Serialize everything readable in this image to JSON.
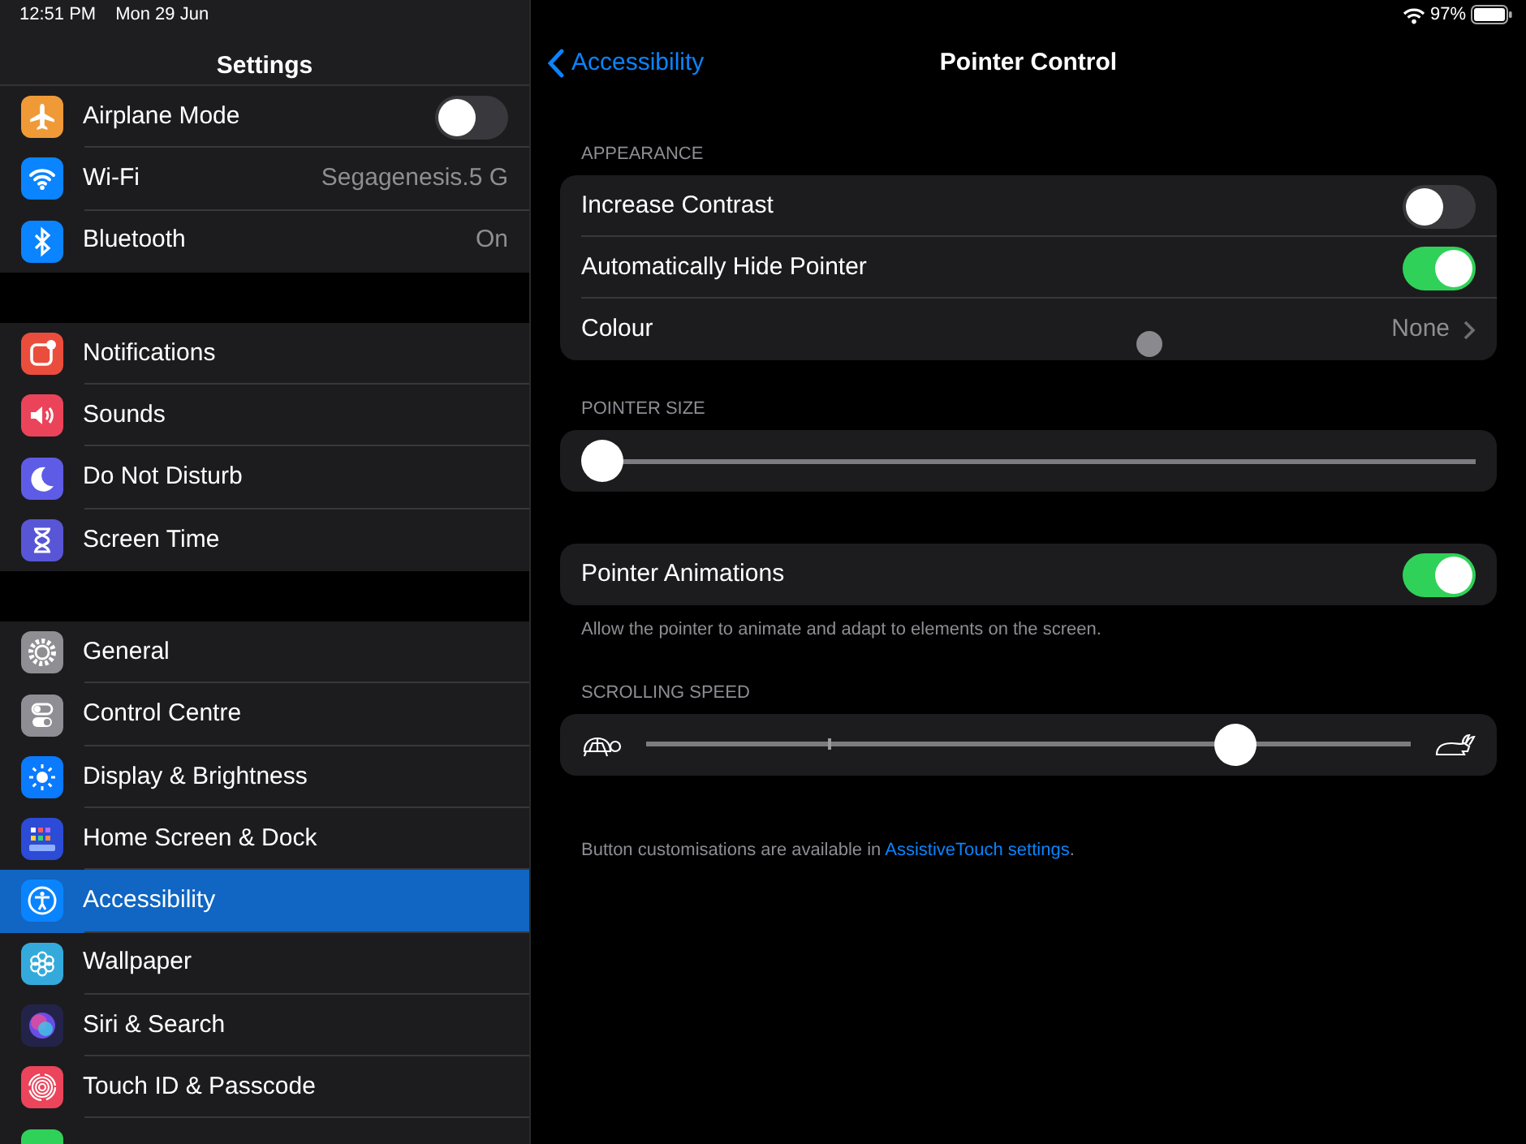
{
  "status_bar": {
    "time": "12:51 PM",
    "date": "Mon 29 Jun",
    "battery": "97%"
  },
  "sidebar": {
    "title": "Settings",
    "groups": [
      {
        "items": [
          {
            "label": "Airplane Mode",
            "kind": "airplane",
            "color": "#f09a37",
            "on": false,
            "selected": false
          },
          {
            "label": "Wi-Fi",
            "kind": "wifi",
            "color": "#0a84ff",
            "value": "Segagenesis.5 G",
            "selected": false
          },
          {
            "label": "Bluetooth",
            "kind": "bluetooth",
            "color": "#0a84ff",
            "value": "On",
            "selected": false
          }
        ]
      },
      {
        "items": [
          {
            "label": "Notifications",
            "kind": "notification",
            "color": "#eb4d3d",
            "selected": false
          },
          {
            "label": "Sounds",
            "kind": "speaker",
            "color": "#eb445a",
            "selected": false
          },
          {
            "label": "Do Not Disturb",
            "kind": "moon",
            "color": "#5e5ce6",
            "selected": false
          },
          {
            "label": "Screen Time",
            "kind": "hourglass",
            "color": "#5856d6",
            "selected": false
          }
        ]
      },
      {
        "items": [
          {
            "label": "General",
            "kind": "gear",
            "color": "#8e8e93",
            "selected": false
          },
          {
            "label": "Control Centre",
            "kind": "toggles",
            "color": "#8e8e94",
            "selected": false
          },
          {
            "label": "Display & Brightness",
            "kind": "sun",
            "color": "#0a7aff",
            "selected": false
          },
          {
            "label": "Home Screen & Dock",
            "kind": "grid",
            "color": "#2c4bd6",
            "selected": false
          },
          {
            "label": "Accessibility",
            "kind": "accessibility",
            "color": "#0a84fe",
            "selected": true
          },
          {
            "label": "Wallpaper",
            "kind": "flower",
            "color": "#34aadc",
            "selected": false
          },
          {
            "label": "Siri & Search",
            "kind": "orb",
            "color": "#23234a",
            "selected": false
          },
          {
            "label": "Touch ID & Passcode",
            "kind": "fingerprint",
            "color": "#eb445b",
            "selected": false
          },
          {
            "kind": "battery",
            "color": "#30d158",
            "selected": false
          }
        ]
      }
    ]
  },
  "nav": {
    "back": "Accessibility",
    "title": "Pointer Control"
  },
  "sections": [
    {
      "kind": "list",
      "header": "APPEARANCE",
      "rows": [
        {
          "label": "Increase Contrast",
          "kind": "toggle",
          "on": false
        },
        {
          "label": "Automatically Hide Pointer",
          "kind": "toggle",
          "on": true
        },
        {
          "label": "Colour",
          "kind": "link",
          "value": "None"
        }
      ]
    },
    {
      "kind": "slider",
      "header": "POINTER SIZE",
      "level": 0
    },
    {
      "kind": "list",
      "rows": [
        {
          "label": "Pointer Animations",
          "kind": "toggle",
          "on": true
        }
      ],
      "footer": "Allow the pointer to animate and adapt to elements on the screen."
    },
    {
      "kind": "speed",
      "header": "SCROLLING SPEED",
      "level": 0.77
    }
  ],
  "note": {
    "text": "Button customisations are available in ",
    "link": "AssistiveTouch settings",
    "end": "."
  }
}
